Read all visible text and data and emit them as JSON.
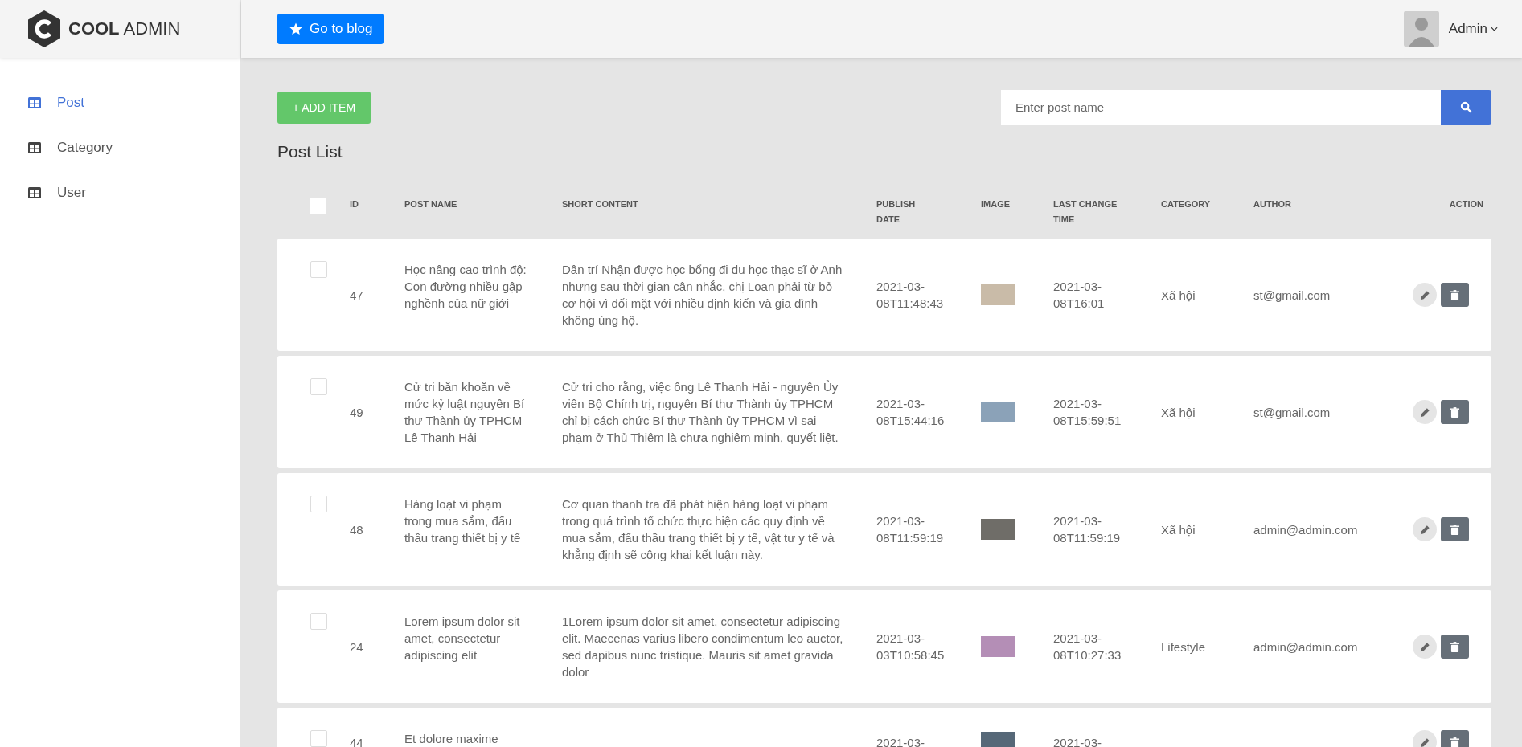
{
  "brand": {
    "bold": "COOL",
    "light": "ADMIN"
  },
  "header": {
    "blog_button": "Go to blog",
    "user": "Admin"
  },
  "sidebar": {
    "items": [
      {
        "label": "Post",
        "selected": true
      },
      {
        "label": "Category",
        "selected": false
      },
      {
        "label": "User",
        "selected": false
      }
    ]
  },
  "toolbar": {
    "add_button": "+ ADD ITEM",
    "search": {
      "placeholder": "Enter post name"
    }
  },
  "title": "Post List",
  "table": {
    "select_all": {
      "checked": false
    },
    "columns": [
      "ID",
      "POST NAME",
      "SHORT CONTENT",
      "PUBLISH DATE",
      "IMAGE",
      "LAST CHANGE TIME",
      "CATEGORY",
      "AUTHOR",
      "ACTION"
    ],
    "rows": [
      {
        "checked": false,
        "id": "47",
        "name": "Học nâng cao trình độ: Con đường nhiều gập nghềnh của nữ giới",
        "content": "Dân trí Nhận được học bổng đi du học thạc sĩ ở Anh nhưng sau thời gian cân nhắc, chị Loan phải từ bỏ cơ hội vì đối mặt với nhiều định kiến và gia đình không ủng hộ.",
        "published": "2021-03-08T11:48:43",
        "changed": "2021-03-08T16:01",
        "category": "Xã hội",
        "author": "st@gmail.com"
      },
      {
        "checked": false,
        "id": "49",
        "name": "Cử tri băn khoăn về mức kỷ luật nguyên Bí thư Thành ủy TPHCM Lê Thanh Hải",
        "content": "Cử tri cho rằng, việc ông Lê Thanh Hải - nguyên Ủy viên Bộ Chính trị, nguyên Bí thư Thành ủy TPHCM chỉ bị cách chức Bí thư Thành ủy TPHCM vì sai phạm ở Thủ Thiêm là chưa nghiêm minh, quyết liệt.",
        "published": "2021-03-08T15:44:16",
        "changed": "2021-03-08T15:59:51",
        "category": "Xã hội",
        "author": "st@gmail.com"
      },
      {
        "checked": false,
        "id": "48",
        "name": "Hàng loạt vi phạm trong mua sắm, đấu thầu trang thiết bị y tế",
        "content": "Cơ quan thanh tra đã phát hiện hàng loạt vi phạm trong quá trình tổ chức thực hiện các quy định về mua sắm, đấu thầu trang thiết bị y tế, vật tư y tế và khẳng định sẽ công khai kết luận này.",
        "published": "2021-03-08T11:59:19",
        "changed": "2021-03-08T11:59:19",
        "category": "Xã hội",
        "author": "admin@admin.com"
      },
      {
        "checked": false,
        "id": "24",
        "name": "Lorem ipsum dolor sit amet, consectetur adipiscing elit",
        "content": "1Lorem ipsum dolor sit amet, consectetur adipiscing elit. Maecenas varius libero condimentum leo auctor, sed dapibus nunc tristique. Mauris sit amet gravida dolor",
        "published": "2021-03-03T10:58:45",
        "changed": "2021-03-08T10:27:33",
        "category": "Lifestyle",
        "author": "admin@admin.com"
      },
      {
        "checked": false,
        "id": "44",
        "name": "Et dolore maxime",
        "published": "2021-03-",
        "changed": "2021-03-"
      }
    ]
  }
}
